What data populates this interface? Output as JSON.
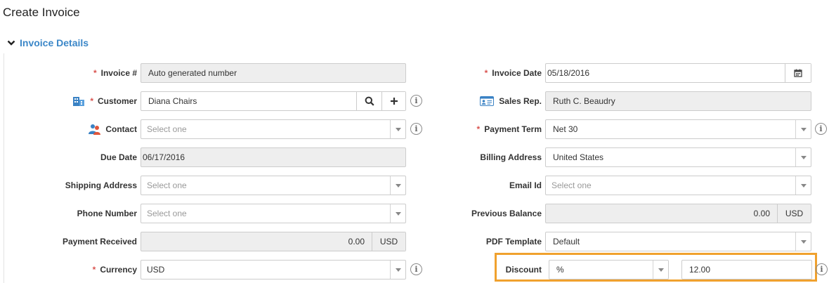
{
  "page": {
    "title": "Create Invoice"
  },
  "section": {
    "title": "Invoice Details"
  },
  "left": {
    "invoice_no": {
      "label": "Invoice #",
      "value": "Auto generated number"
    },
    "customer": {
      "label": "Customer",
      "value": "Diana Chairs"
    },
    "contact": {
      "label": "Contact",
      "placeholder": "Select one"
    },
    "due_date": {
      "label": "Due Date",
      "value": "06/17/2016"
    },
    "shipping_address": {
      "label": "Shipping Address",
      "placeholder": "Select one"
    },
    "phone_number": {
      "label": "Phone Number",
      "placeholder": "Select one"
    },
    "payment_received": {
      "label": "Payment Received",
      "value": "0.00",
      "currency": "USD"
    },
    "currency": {
      "label": "Currency",
      "value": "USD"
    }
  },
  "right": {
    "invoice_date": {
      "label": "Invoice Date",
      "value": "05/18/2016"
    },
    "sales_rep": {
      "label": "Sales Rep.",
      "value": "Ruth C. Beaudry"
    },
    "payment_term": {
      "label": "Payment Term",
      "value": "Net 30"
    },
    "billing_address": {
      "label": "Billing Address",
      "value": "United States"
    },
    "email_id": {
      "label": "Email Id",
      "placeholder": "Select one"
    },
    "previous_balance": {
      "label": "Previous Balance",
      "value": "0.00",
      "currency": "USD"
    },
    "pdf_template": {
      "label": "PDF Template",
      "value": "Default"
    },
    "discount": {
      "label": "Discount",
      "type": "%",
      "value": "12.00"
    }
  },
  "common": {
    "required_mark": "*",
    "info_glyph": "i"
  },
  "icons": {
    "customer": "building-icon",
    "contact": "people-icon",
    "sales_rep": "id-card-icon",
    "search": "search-icon",
    "add": "plus-icon",
    "calendar": "calendar-icon",
    "section_toggle": "chevron-down-icon"
  },
  "colors": {
    "accent": "#3b87c8",
    "required": "#d9534f",
    "highlight": "#f0a12e"
  }
}
